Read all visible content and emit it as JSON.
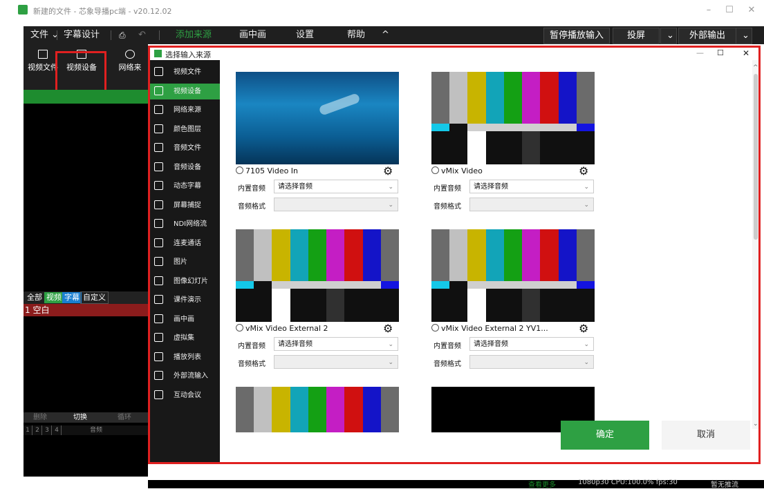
{
  "app": {
    "title": "新建的文件 - 芯象导播pc端 - v20.12.02",
    "brand_color": "#2ea043",
    "highlight_color": "#e02020"
  },
  "window_controls": {
    "minimize": "–",
    "maximize": "☐",
    "close": "✕"
  },
  "menubar": {
    "file": "文件 ⌄",
    "subtitle_design": "字幕设计",
    "add_source": "添加来源",
    "pip": "画中画",
    "settings": "设置",
    "help": "帮助",
    "collapse": "^",
    "pause_input": "暂停播放输入",
    "cast": "投屏",
    "external_output": "外部输出",
    "dropdown": "⌄"
  },
  "toolbar": {
    "items": [
      {
        "label": "视频文件",
        "icon": "play-file-icon"
      },
      {
        "label": "视频设备",
        "icon": "camera-icon"
      },
      {
        "label": "网络来",
        "icon": "network-icon"
      }
    ]
  },
  "left_panel": {
    "tabs": [
      "全部",
      "视频",
      "字幕",
      "自定义"
    ],
    "blank_row": "1 空白",
    "controls": [
      "删除",
      "切换",
      "循环"
    ],
    "numbers": [
      "1",
      "2",
      "3",
      "4"
    ],
    "audio": "音频"
  },
  "statusbar": {
    "more": "查看更多",
    "info": "1080p30  CPU:100.0%  fps:30",
    "stream": "暂无推流"
  },
  "dialog": {
    "title": "选择输入来源",
    "controls": {
      "minimize": "—",
      "maximize": "☐",
      "close": "✕"
    },
    "sidebar": [
      {
        "label": "视频文件",
        "icon": "video-file-icon",
        "active": false
      },
      {
        "label": "视频设备",
        "icon": "video-device-icon",
        "active": true
      },
      {
        "label": "网络来源",
        "icon": "network-source-icon",
        "active": false
      },
      {
        "label": "颜色图层",
        "icon": "palette-icon",
        "active": false
      },
      {
        "label": "音频文件",
        "icon": "audio-file-icon",
        "active": false
      },
      {
        "label": "音频设备",
        "icon": "microphone-icon",
        "active": false
      },
      {
        "label": "动态字幕",
        "icon": "text-icon",
        "active": false
      },
      {
        "label": "屏幕捕捉",
        "icon": "monitor-icon",
        "active": false
      },
      {
        "label": "NDI网络流",
        "icon": "ndi-icon",
        "active": false
      },
      {
        "label": "连麦通话",
        "icon": "call-icon",
        "active": false
      },
      {
        "label": "图片",
        "icon": "image-icon",
        "active": false
      },
      {
        "label": "图像幻灯片",
        "icon": "slideshow-icon",
        "active": false
      },
      {
        "label": "课件演示",
        "icon": "presentation-icon",
        "active": false
      },
      {
        "label": "画中画",
        "icon": "pip-icon",
        "active": false
      },
      {
        "label": "虚拟集",
        "icon": "virtual-set-icon",
        "active": false
      },
      {
        "label": "播放列表",
        "icon": "playlist-icon",
        "active": false
      },
      {
        "label": "外部流输入",
        "icon": "external-stream-icon",
        "active": false
      },
      {
        "label": "互动会议",
        "icon": "meeting-icon",
        "active": false
      }
    ],
    "devices": [
      {
        "name": "7105 Video In",
        "thumb": "ocean",
        "audio_label": "内置音频",
        "audio_value": "请选择音频",
        "format_label": "音频格式",
        "format_value": ""
      },
      {
        "name": "vMix Video",
        "thumb": "bars",
        "audio_label": "内置音频",
        "audio_value": "请选择音频",
        "format_label": "音频格式",
        "format_value": ""
      },
      {
        "name": "vMix Video External 2",
        "thumb": "bars",
        "audio_label": "内置音频",
        "audio_value": "请选择音频",
        "format_label": "音频格式",
        "format_value": ""
      },
      {
        "name": "vMix Video External 2 YV1...",
        "thumb": "bars",
        "audio_label": "内置音频",
        "audio_value": "请选择音频",
        "format_label": "音频格式",
        "format_value": ""
      }
    ],
    "ok": "确定",
    "cancel": "取消"
  }
}
